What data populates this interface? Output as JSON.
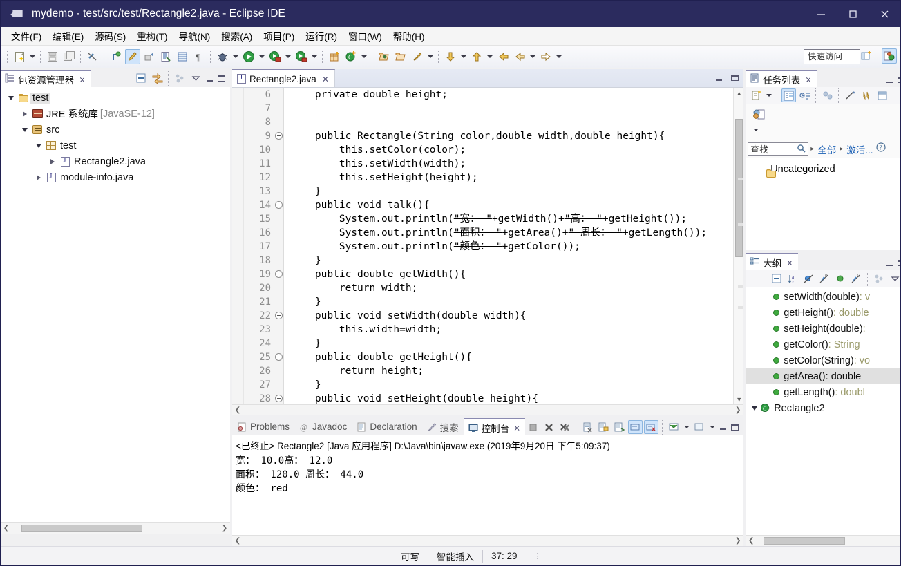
{
  "window": {
    "title": "mydemo - test/src/test/Rectangle2.java - Eclipse IDE",
    "app_icon": "eclipse-icon",
    "minimize_label": "─",
    "maximize_label": "❑",
    "close_label": "✕",
    "titlebar_color": "#2b2b5e"
  },
  "menubar": {
    "items": [
      {
        "label": "文件(F)",
        "name": "menu-file"
      },
      {
        "label": "编辑(E)",
        "name": "menu-edit"
      },
      {
        "label": "源码(S)",
        "name": "menu-source"
      },
      {
        "label": "重构(T)",
        "name": "menu-refactor"
      },
      {
        "label": "导航(N)",
        "name": "menu-navigate"
      },
      {
        "label": "搜索(A)",
        "name": "menu-search"
      },
      {
        "label": "项目(P)",
        "name": "menu-project"
      },
      {
        "label": "运行(R)",
        "name": "menu-run"
      },
      {
        "label": "窗口(W)",
        "name": "menu-window"
      },
      {
        "label": "帮助(H)",
        "name": "menu-help"
      }
    ]
  },
  "toolbar": {
    "quick_access_value": "快速访问",
    "icons": [
      "new-wizard-icon",
      "save-icon",
      "save-all-icon",
      "link-break-icon",
      "toggle-mark-occurrences-icon",
      "skip-breakpoints-icon",
      "build-icon",
      "external-tools-icon",
      "show-whitespace-icon",
      "debug-icon",
      "run-icon",
      "run-coverage-icon",
      "run-external-icon",
      "new-package-icon",
      "new-class-icon",
      "open-type-icon",
      "open-task-icon",
      "search-icon",
      "next-annotation-icon",
      "previous-annotation-icon",
      "back-icon",
      "forward-left-icon",
      "forward-right-icon"
    ]
  },
  "package_explorer": {
    "tab_label": "包资源管理器",
    "close_glyph": "⨯",
    "tree": [
      {
        "label": "test",
        "icon": "project-folder-icon",
        "indent": 0,
        "state": "open",
        "selected": true,
        "suffix": ""
      },
      {
        "label": "JRE 系统库",
        "icon": "jre-library-icon",
        "indent": 1,
        "state": "closed",
        "selected": false,
        "suffix": "[JavaSE-12]"
      },
      {
        "label": "src",
        "icon": "source-folder-icon",
        "indent": 1,
        "state": "open",
        "selected": false,
        "suffix": ""
      },
      {
        "label": "test",
        "icon": "package-icon",
        "indent": 2,
        "state": "open",
        "selected": false,
        "suffix": ""
      },
      {
        "label": "Rectangle2.java",
        "icon": "java-file-icon",
        "indent": 3,
        "state": "closed",
        "selected": false,
        "suffix": ""
      },
      {
        "label": "module-info.java",
        "icon": "java-file-icon",
        "indent": 2,
        "state": "closed",
        "selected": false,
        "suffix": ""
      }
    ]
  },
  "editor": {
    "tab_label": "Rectangle2.java",
    "tab_icon": "java-file-icon",
    "close_glyph": "⨯",
    "first_line_number": 6,
    "lines": [
      {
        "n": 6,
        "fold": false,
        "html": "    <k>private</k> <k>double</k> <pl>height</pl>;"
      },
      {
        "n": 7,
        "fold": false,
        "html": ""
      },
      {
        "n": 8,
        "fold": false,
        "html": ""
      },
      {
        "n": 9,
        "fold": true,
        "html": "    <k>public</k> Rectangle(String <pl>color</pl>,<k>double</k> <pl>width</pl>,<k>double</k> <pl>height</pl>){"
      },
      {
        "n": 10,
        "fold": false,
        "html": "        <k>this</k>.setColor(<pl>color</pl>);"
      },
      {
        "n": 11,
        "fold": false,
        "html": "        <k>this</k>.setWidth(<pl>width</pl>);"
      },
      {
        "n": 12,
        "fold": false,
        "html": "        <k>this</k>.setHeight(<pl>height</pl>);"
      },
      {
        "n": 13,
        "fold": false,
        "html": "    }"
      },
      {
        "n": 14,
        "fold": true,
        "html": "    <k>public</k> <k>void</k> talk(){"
      },
      {
        "n": 15,
        "fold": false,
        "html": "        System.<fl>out</fl>.println(<s>\"宽： \"</s>+getWidth()+<s>\"高： \"</s>+<hl>getHeight</hl>());"
      },
      {
        "n": 16,
        "fold": false,
        "html": "        System.<fl>out</fl>.println(<s>\"面积： \"</s>+getArea()+<s>\" 周长： \"</s>+getLength());"
      },
      {
        "n": 17,
        "fold": false,
        "html": "        System.<fl>out</fl>.println(<s>\"颜色： \"</s>+getColor());"
      },
      {
        "n": 18,
        "fold": false,
        "html": "    }"
      },
      {
        "n": 19,
        "fold": true,
        "html": "    <k>public</k> <k>double</k> getWidth(){"
      },
      {
        "n": 20,
        "fold": false,
        "html": "        <k>return</k> <pl>width</pl>;"
      },
      {
        "n": 21,
        "fold": false,
        "html": "    }"
      },
      {
        "n": 22,
        "fold": true,
        "html": "    <k>public</k> <k>void</k> setWidth(<k>double</k> <pl>width</pl>){"
      },
      {
        "n": 23,
        "fold": false,
        "html": "        <k>this</k>.<pl>width</pl>=<pl>width</pl>;"
      },
      {
        "n": 24,
        "fold": false,
        "html": "    }"
      },
      {
        "n": 25,
        "fold": true,
        "html": "    <k>public</k> <k>double</k> <hl>getHeight</hl>(){"
      },
      {
        "n": 26,
        "fold": false,
        "html": "        <k>return</k> <pl>height</pl>;"
      },
      {
        "n": 27,
        "fold": false,
        "html": "    }"
      },
      {
        "n": 28,
        "fold": true,
        "html": "    <k>public</k> <k>void</k> setHeight(<k>double</k> <pl>height</pl>){"
      }
    ]
  },
  "console": {
    "tabs": [
      {
        "label": "Problems",
        "icon": "problems-icon",
        "selected": false
      },
      {
        "label": "Javadoc",
        "icon": "javadoc-icon",
        "selected": false
      },
      {
        "label": "Declaration",
        "icon": "declaration-icon",
        "selected": false
      },
      {
        "label": "搜索",
        "icon": "search-icon",
        "selected": false
      },
      {
        "label": "控制台",
        "icon": "console-icon",
        "selected": true
      }
    ],
    "close_glyph": "⨯",
    "header": "<已终止> Rectangle2 [Java 应用程序] D:\\Java\\bin\\javaw.exe  (2019年9月20日 下午5:09:37)",
    "output": [
      "宽： 10.0高： 12.0",
      "面积： 120.0 周长： 44.0",
      "颜色： red"
    ],
    "toolbar_icons": [
      "terminate-all-icon",
      "remove-launch-icon",
      "remove-all-launches-icon",
      "clear-console-icon",
      "scroll-lock-icon",
      "word-wrap-icon",
      "pin-console-icon",
      "display-selected-console-icon",
      "open-console-icon",
      "new-console-view-icon"
    ]
  },
  "task_list": {
    "tab_label": "任务列表",
    "close_glyph": "⨯",
    "find_placeholder": "查找",
    "filter_all": "全部",
    "filter_active": "激活...",
    "help_glyph": "⍰",
    "items": [
      {
        "label": "Uncategorized",
        "icon": "category-folder-icon"
      }
    ],
    "toolbar_icons": [
      "new-task-icon",
      "categorized-mode-icon",
      "scheduled-mode-icon",
      "synchronize-icon",
      "collapse-all-icon",
      "filter-icon",
      "restore-icon"
    ]
  },
  "outline": {
    "tab_label": "大纲",
    "close_glyph": "⨯",
    "items": [
      {
        "name": "setWidth(double)",
        "type": " : v",
        "selected": false
      },
      {
        "name": "getHeight()",
        "type": " : double",
        "selected": false
      },
      {
        "name": "setHeight(double)",
        "type": " : ",
        "selected": false
      },
      {
        "name": "getColor()",
        "type": " : String",
        "selected": false
      },
      {
        "name": "setColor(String)",
        "type": " : vo",
        "selected": false
      },
      {
        "name": "getArea()",
        "type": " : double",
        "selected": true
      },
      {
        "name": "getLength()",
        "type": " : doubl",
        "selected": false
      }
    ],
    "class_item": {
      "name": "Rectangle2",
      "icon": "class-icon"
    },
    "toolbar_icons": [
      "collapse-all-icon",
      "sort-icon",
      "hide-fields-icon",
      "hide-static-icon",
      "hide-nonpublic-icon",
      "hide-local-types-icon",
      "link-with-editor-icon",
      "view-menu-icon"
    ]
  },
  "statusbar": {
    "writable": "可写",
    "insert_mode": "智能插入",
    "position": "37: 29",
    "dots": "⋮"
  }
}
